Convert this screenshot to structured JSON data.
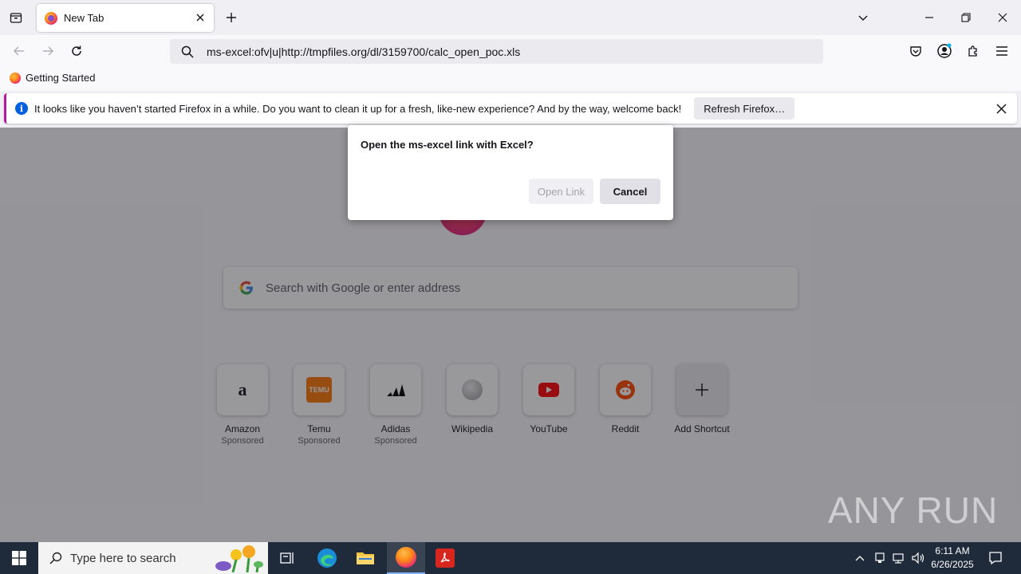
{
  "browser": {
    "tab": {
      "title": "New Tab",
      "close_icon": "close-icon"
    },
    "url": "ms-excel:ofv|u|http://tmpfiles.org/dl/3159700/calc_open_poc.xls",
    "bookmark": "Getting Started"
  },
  "notification": {
    "message": "It looks like you haven’t started Firefox in a while. Do you want to clean it up for a fresh, like-new experience? And by the way, welcome back!",
    "button": "Refresh Firefox…",
    "accent": "#b31ba0"
  },
  "dialog": {
    "question": "Open the ms-excel link with Excel?",
    "open_label": "Open Link",
    "cancel_label": "Cancel"
  },
  "newtab": {
    "search_placeholder": "Search with Google or enter address",
    "shortcuts": [
      {
        "name": "Amazon",
        "sponsored": "Sponsored"
      },
      {
        "name": "Temu",
        "sponsored": "Sponsored"
      },
      {
        "name": "Adidas",
        "sponsored": "Sponsored"
      },
      {
        "name": "Wikipedia",
        "sponsored": ""
      },
      {
        "name": "YouTube",
        "sponsored": ""
      },
      {
        "name": "Reddit",
        "sponsored": ""
      },
      {
        "name": "Add Shortcut",
        "sponsored": ""
      }
    ]
  },
  "watermark": "ANY RUN",
  "taskbar": {
    "search_text": "Type here to search",
    "time": "6:11 AM",
    "date": "6/26/2025"
  }
}
